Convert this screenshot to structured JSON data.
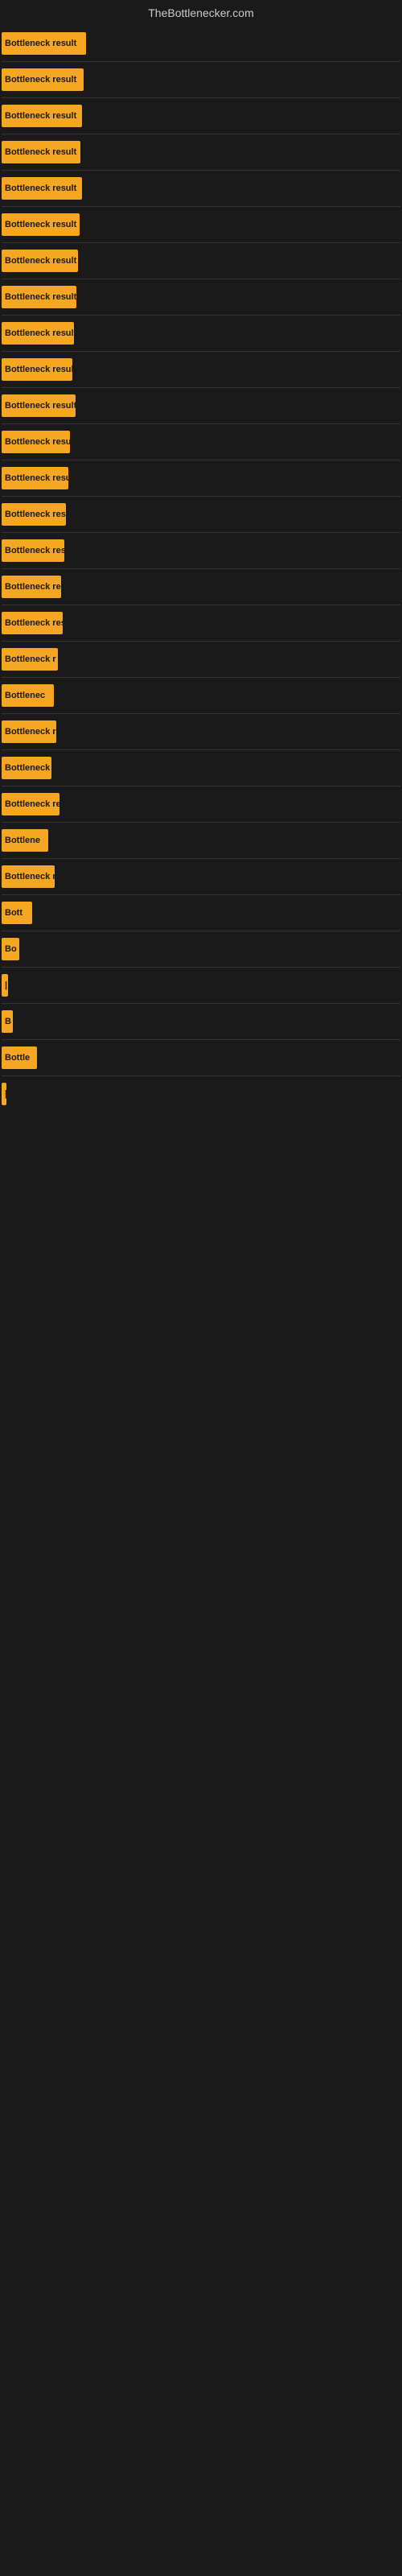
{
  "site": {
    "title": "TheBottlenecker.com"
  },
  "bars": [
    {
      "label": "Bottleneck result",
      "width": 105
    },
    {
      "label": "Bottleneck result",
      "width": 102
    },
    {
      "label": "Bottleneck result",
      "width": 100
    },
    {
      "label": "Bottleneck result",
      "width": 98
    },
    {
      "label": "Bottleneck result",
      "width": 100
    },
    {
      "label": "Bottleneck result",
      "width": 97
    },
    {
      "label": "Bottleneck result",
      "width": 95
    },
    {
      "label": "Bottleneck result",
      "width": 93
    },
    {
      "label": "Bottleneck result",
      "width": 90
    },
    {
      "label": "Bottleneck result",
      "width": 88
    },
    {
      "label": "Bottleneck result",
      "width": 92
    },
    {
      "label": "Bottleneck result",
      "width": 85
    },
    {
      "label": "Bottleneck result",
      "width": 83
    },
    {
      "label": "Bottleneck result",
      "width": 80
    },
    {
      "label": "Bottleneck result",
      "width": 78
    },
    {
      "label": "Bottleneck re",
      "width": 74
    },
    {
      "label": "Bottleneck result",
      "width": 76
    },
    {
      "label": "Bottleneck r",
      "width": 70
    },
    {
      "label": "Bottlenec",
      "width": 65
    },
    {
      "label": "Bottleneck r",
      "width": 68
    },
    {
      "label": "Bottleneck",
      "width": 62
    },
    {
      "label": "Bottleneck res",
      "width": 72
    },
    {
      "label": "Bottlene",
      "width": 58
    },
    {
      "label": "Bottleneck r",
      "width": 66
    },
    {
      "label": "Bott",
      "width": 38
    },
    {
      "label": "Bo",
      "width": 22
    },
    {
      "label": "|",
      "width": 8
    },
    {
      "label": "B",
      "width": 14
    },
    {
      "label": "Bottle",
      "width": 44
    },
    {
      "label": "|",
      "width": 6
    }
  ]
}
